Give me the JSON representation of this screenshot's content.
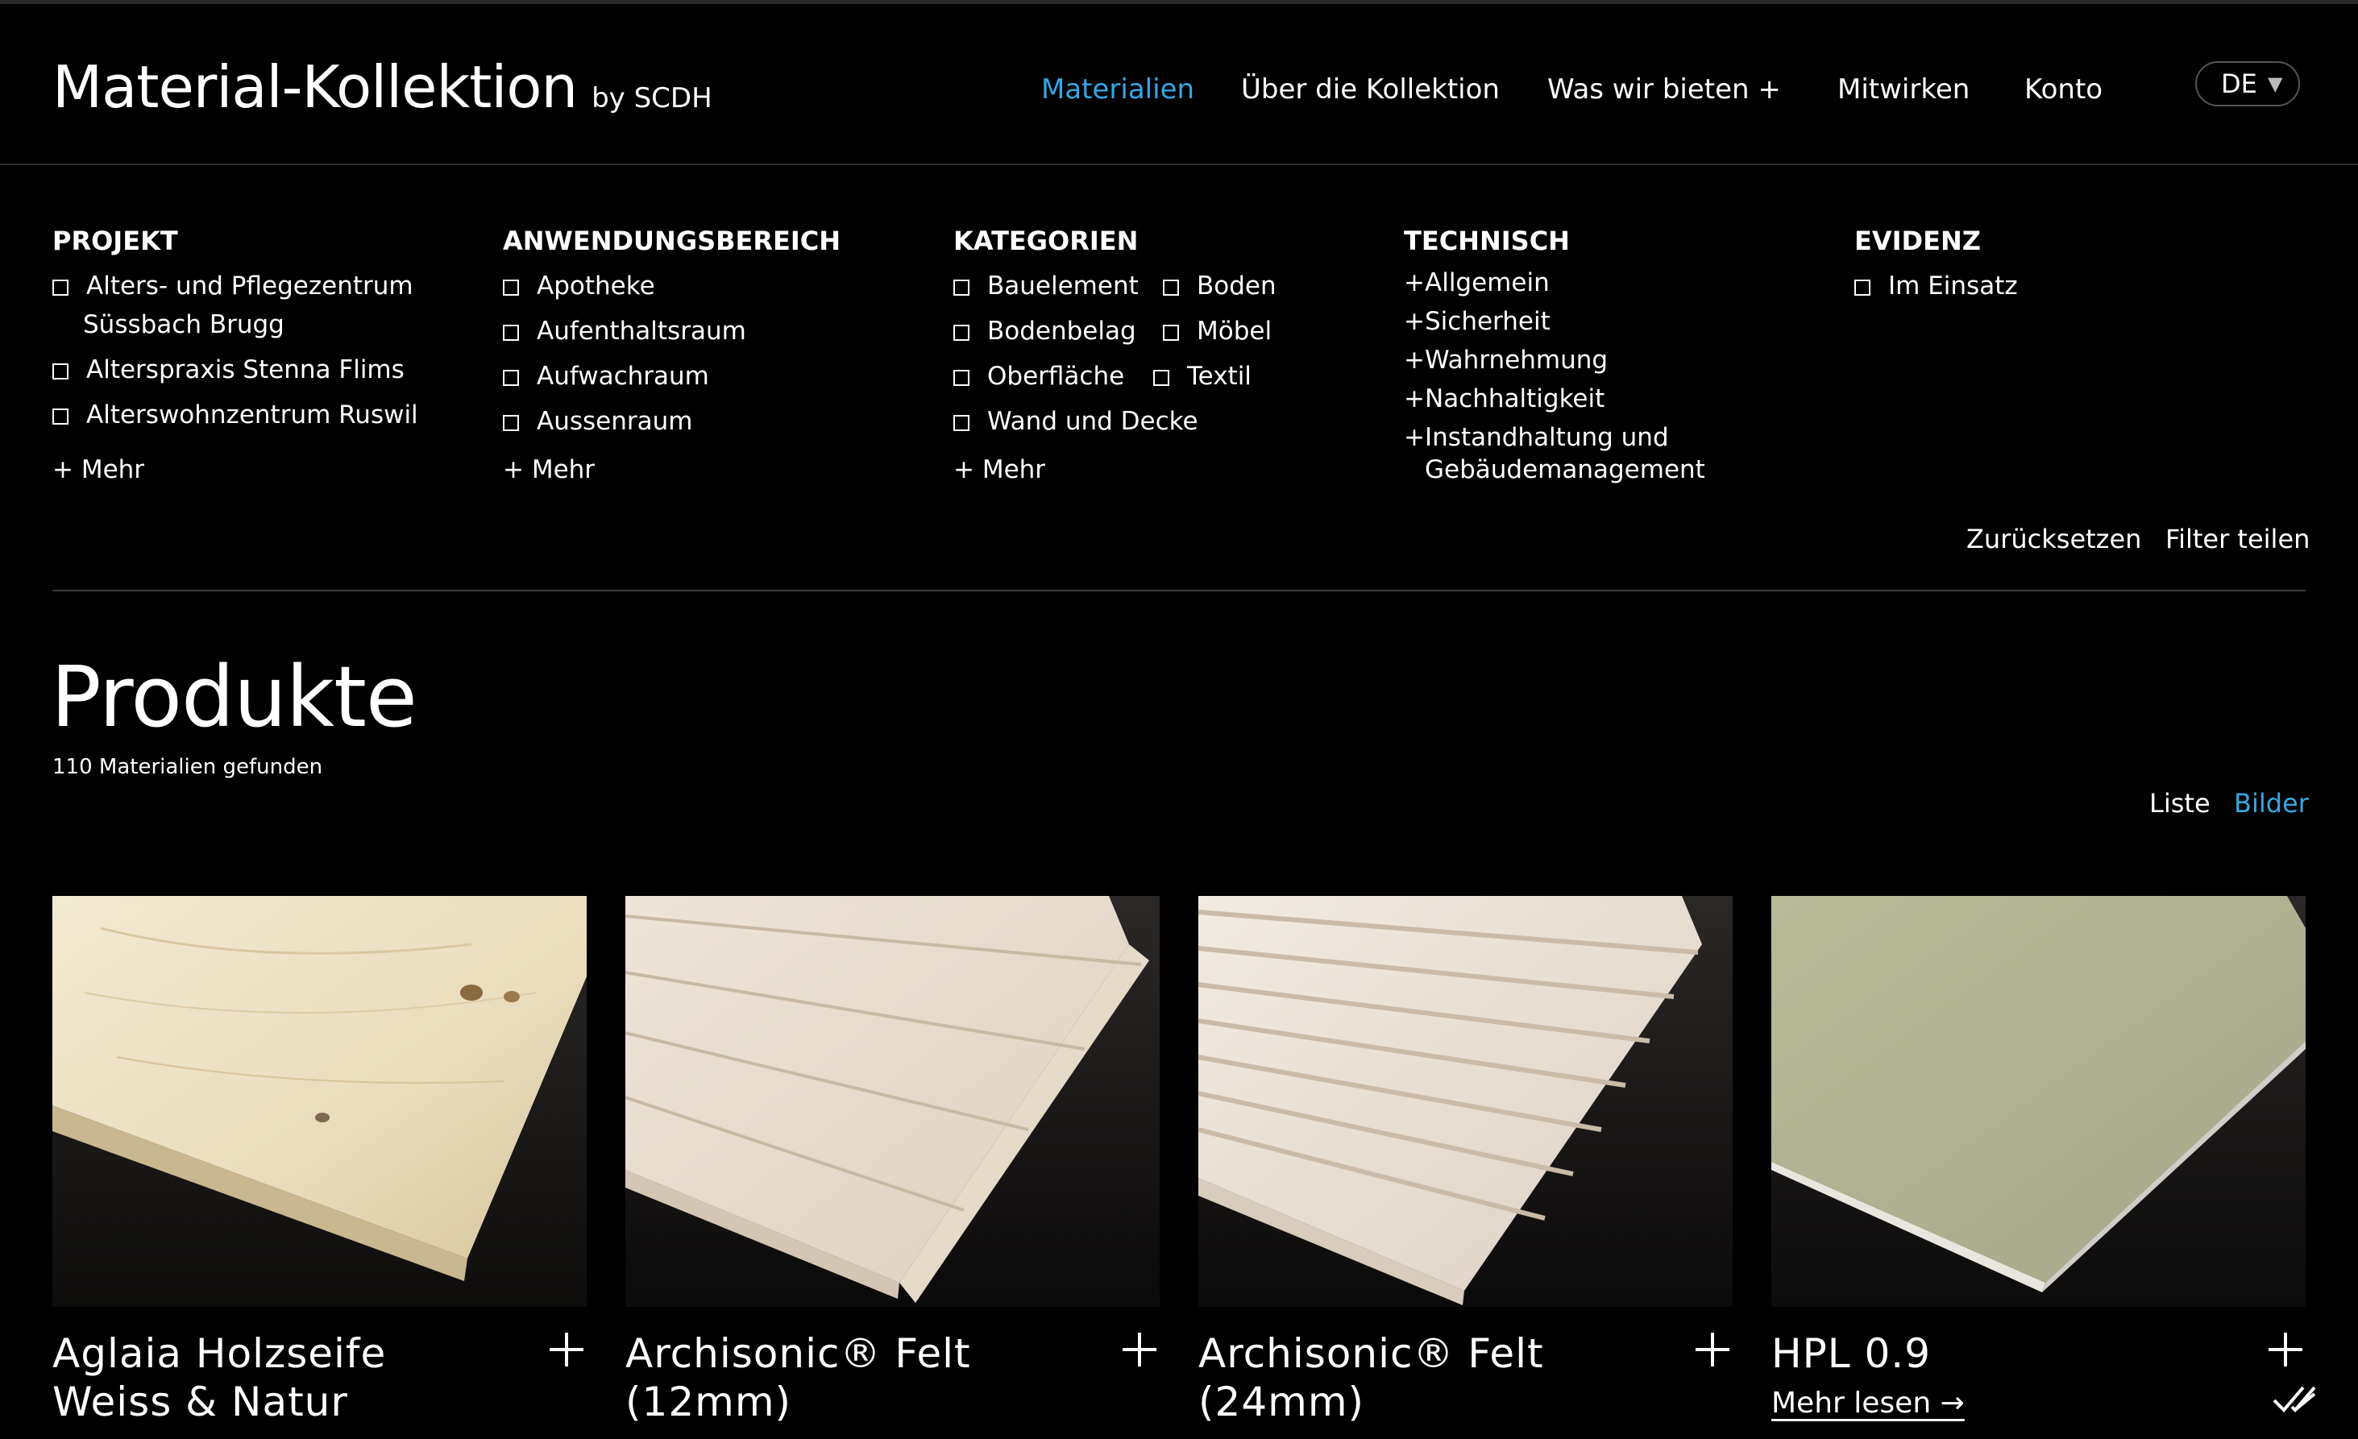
{
  "header": {
    "title": "Material-Kollektion",
    "by": "by SCDH",
    "nav": [
      {
        "label": "Materialien",
        "active": true
      },
      {
        "label": "Über die Kollektion",
        "active": false
      },
      {
        "label": "Was wir bieten +",
        "active": false
      },
      {
        "label": "Mitwirken",
        "active": false
      },
      {
        "label": "Konto",
        "active": false
      }
    ],
    "language": "DE",
    "language_caret": "▼"
  },
  "filters": {
    "projekt": {
      "heading": "PROJEKT",
      "options": [
        "Alters- und Pflegezentrum",
        "Süssbach Brugg",
        "Alterspraxis Stenna Flims",
        "Alterswohnzentrum Ruswil"
      ],
      "more": "+ Mehr"
    },
    "anwendungsbereich": {
      "heading": "ANWENDUNGSBEREICH",
      "options": [
        "Apotheke",
        "Aufenthaltsraum",
        "Aufwachraum",
        "Aussenraum"
      ],
      "more": "+ Mehr"
    },
    "kategorien": {
      "heading": "KATEGORIEN",
      "options": [
        "Bauelement",
        "Boden",
        "Bodenbelag",
        "Möbel",
        "Oberfläche",
        "Textil",
        "Wand und Decke"
      ],
      "more": "+ Mehr"
    },
    "technisch": {
      "heading": "TECHNISCH",
      "plus": "+",
      "items": [
        "Allgemein",
        "Sicherheit",
        "Wahrnehmung",
        "Nachhaltigkeit",
        "Instandhaltung und",
        "Gebäudemanagement"
      ]
    },
    "evidenz": {
      "heading": "EVIDENZ",
      "options": [
        "Im Einsatz"
      ]
    },
    "actions": {
      "reset": "Zurücksetzen",
      "share": "Filter teilen"
    }
  },
  "products": {
    "title": "Produkte",
    "count": "110 Materialien gefunden",
    "view_options": [
      {
        "label": "Liste",
        "active": false
      },
      {
        "label": "Bilder",
        "active": true
      }
    ],
    "items": [
      {
        "name": "Aglaia Holzseife Weiss & Natur",
        "image": "pine-wood-panel"
      },
      {
        "name": "Archisonic® Felt (12mm)",
        "image": "grooved-felt-panel"
      },
      {
        "name": "Archisonic® Felt (24mm)",
        "image": "ribbed-felt-panel"
      },
      {
        "name": "HPL 0.9",
        "image": "green-laminate-panel",
        "read_more": "Mehr lesen →"
      }
    ]
  },
  "colors": {
    "accent": "#35a7e6",
    "background": "#000000",
    "text": "#ffffff"
  },
  "icons": {
    "add": "plus-icon",
    "compare": "double-check-icon",
    "dropdown": "chevron-down-icon"
  }
}
